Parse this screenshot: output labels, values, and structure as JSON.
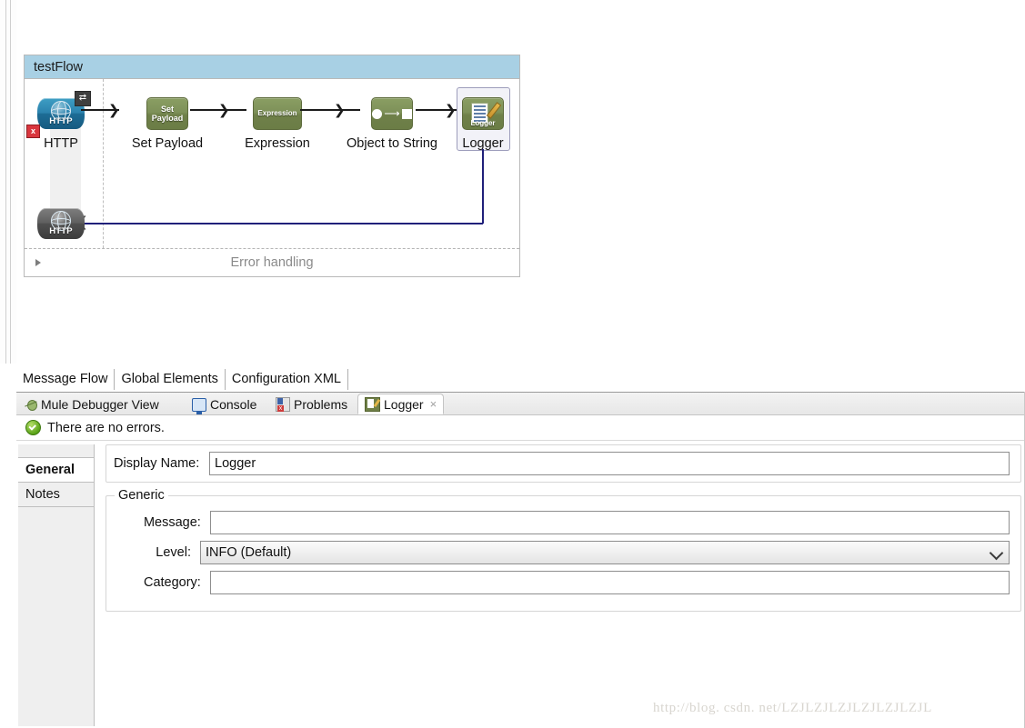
{
  "flow": {
    "title": "testFlow",
    "error_handling_label": "Error handling",
    "nodes": [
      {
        "id": "http-in",
        "label": "HTTP",
        "icon": "http-endpoint-icon",
        "badge": "sync-badge",
        "error_badge": "x"
      },
      {
        "id": "set-payload",
        "label": "Set Payload",
        "icon": "set-payload-icon",
        "icon_text_line1": "Set",
        "icon_text_line2": "Payload"
      },
      {
        "id": "expression",
        "label": "Expression",
        "icon": "expression-icon",
        "icon_text_line1": "Expression"
      },
      {
        "id": "object-to-string",
        "label": "Object to String",
        "icon": "object-to-string-icon"
      },
      {
        "id": "logger",
        "label": "Logger",
        "icon": "logger-icon",
        "icon_text_line1": "Logger",
        "selected": true
      },
      {
        "id": "http-out",
        "label": "",
        "icon": "http-endpoint-out-icon"
      }
    ],
    "http_icon_text": "HTTP"
  },
  "editor_tabs": [
    {
      "label": "Message Flow",
      "active": true
    },
    {
      "label": "Global Elements",
      "active": false
    },
    {
      "label": "Configuration XML",
      "active": false
    }
  ],
  "view_tabs": [
    {
      "label": "Mule Debugger View",
      "icon": "bug-icon",
      "active": false,
      "closable": false
    },
    {
      "label": "Console",
      "icon": "console-icon",
      "active": false,
      "closable": false
    },
    {
      "label": "Problems",
      "icon": "problems-icon",
      "active": false,
      "closable": false
    },
    {
      "label": "Logger",
      "icon": "logger-icon",
      "active": true,
      "closable": true,
      "close_glyph": "×"
    }
  ],
  "status": {
    "icon": "ok-check-icon",
    "text": "There are no errors."
  },
  "side_tabs": [
    {
      "label": "General",
      "active": true
    },
    {
      "label": "Notes",
      "active": false
    }
  ],
  "properties": {
    "display_name_label": "Display Name:",
    "display_name_value": "Logger",
    "generic_legend": "Generic",
    "message_label": "Message:",
    "message_value": "",
    "message_placeholder": "",
    "level_label": "Level:",
    "level_value": "INFO (Default)",
    "level_options": [
      "INFO (Default)"
    ],
    "category_label": "Category:",
    "category_value": "",
    "category_placeholder": ""
  },
  "watermark": {
    "text": "http://blog. csdn. net/LZJLZJLZJLZJLZJLZJL"
  },
  "colors": {
    "flow_header": "#a8d0e4",
    "processor_green": "#6f8048",
    "http_blue": "#2b82ad",
    "return_arrow": "#20207a",
    "status_ok": "#5aa318"
  }
}
